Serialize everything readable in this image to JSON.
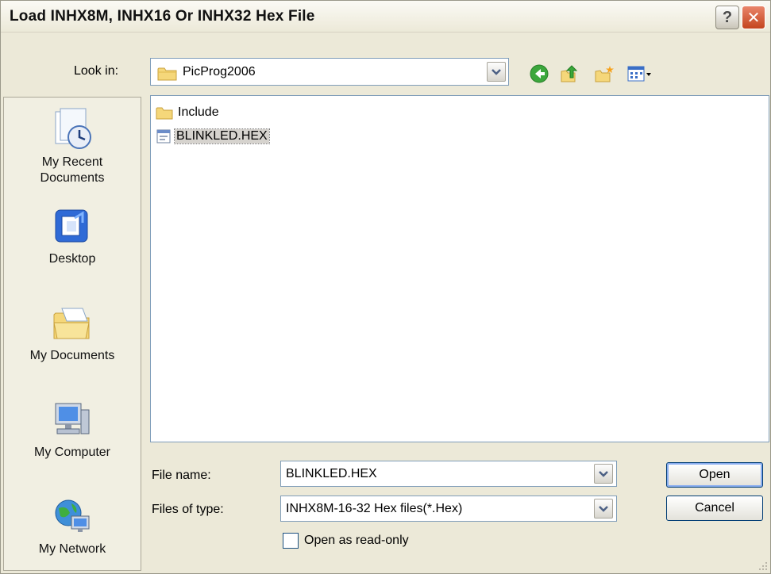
{
  "window": {
    "title": "Load INHX8M, INHX16 Or INHX32 Hex File",
    "help_label": "?",
    "close_label": "✕"
  },
  "lookin": {
    "label": "Look in:",
    "value": "PicProg2006"
  },
  "toolbar": {
    "icons": [
      "back-icon",
      "up-folder-icon",
      "new-folder-icon",
      "views-menu-icon"
    ]
  },
  "places": [
    {
      "label1": "My Recent",
      "label2": "Documents",
      "icon": "recent-documents-icon"
    },
    {
      "label1": "Desktop",
      "label2": "",
      "icon": "desktop-icon"
    },
    {
      "label1": "My Documents",
      "label2": "",
      "icon": "my-documents-icon"
    },
    {
      "label1": "My Computer",
      "label2": "",
      "icon": "my-computer-icon"
    },
    {
      "label1": "My Network",
      "label2": "",
      "icon": "my-network-icon"
    }
  ],
  "files": [
    {
      "name": "Include",
      "type": "folder"
    },
    {
      "name": "BLINKLED.HEX",
      "type": "hex-file",
      "selected": true
    }
  ],
  "filename": {
    "label": "File name:",
    "value": "BLINKLED.HEX"
  },
  "filetype": {
    "label": "Files of type:",
    "value": "INHX8M-16-32 Hex files(*.Hex)"
  },
  "buttons": {
    "open": "Open",
    "cancel": "Cancel"
  },
  "readonly": {
    "label": "Open as read-only",
    "checked": false
  },
  "colors": {
    "dialog_bg": "#ece9d8",
    "close_red": "#c4441e",
    "border_blue": "#7f9db9"
  }
}
